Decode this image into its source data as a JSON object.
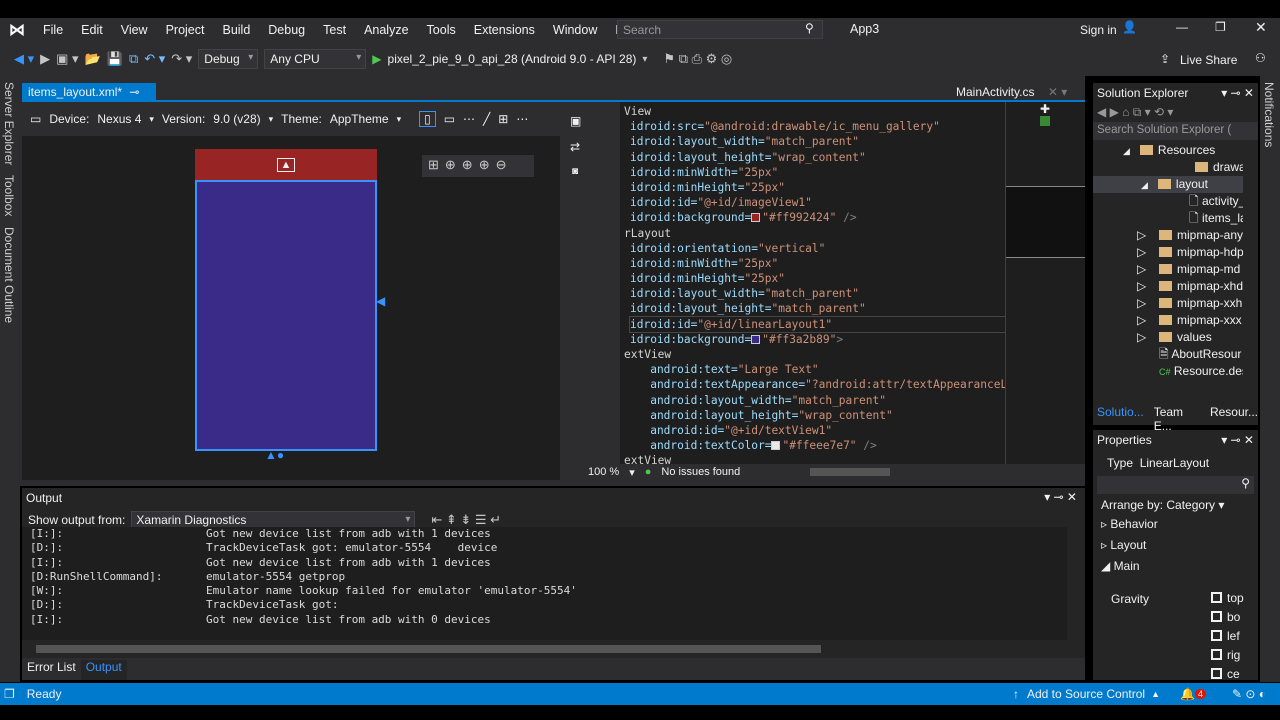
{
  "menu": {
    "items": [
      "File",
      "Edit",
      "View",
      "Project",
      "Build",
      "Debug",
      "Test",
      "Analyze",
      "Tools",
      "Extensions",
      "Window",
      "Help"
    ],
    "search_placeholder": "Search",
    "app_title": "App3",
    "sign_in": "Sign in"
  },
  "toolbar": {
    "config": "Debug",
    "platform": "Any CPU",
    "run_target": "pixel_2_pie_9_0_api_28 (Android 9.0 - API 28)",
    "live_share": "Live Share"
  },
  "left_strip": [
    "Server Explorer",
    "Toolbox",
    "Document Outline"
  ],
  "right_strip": "Notifications",
  "tabs": {
    "active": "items_layout.xml*",
    "other": "MainActivity.cs"
  },
  "designer": {
    "device_label": "Device:",
    "device": "Nexus 4",
    "version_label": "Version:",
    "version": "9.0 (v28)",
    "theme_label": "Theme:",
    "theme": "AppTheme",
    "header_color": "#992424",
    "body_color": "#3a2b89"
  },
  "code": {
    "lines": [
      [
        "View",
        "",
        ""
      ],
      [
        "idroid:src=",
        "\"@android:drawable/ic_menu_gallery\"",
        ""
      ],
      [
        "idroid:layout_width=",
        "\"match_parent\"",
        ""
      ],
      [
        "idroid:layout_height=",
        "\"wrap_content\"",
        ""
      ],
      [
        "idroid:minWidth=",
        "\"25px\"",
        ""
      ],
      [
        "idroid:minHeight=",
        "\"25px\"",
        ""
      ],
      [
        "idroid:id=",
        "\"@+id/imageView1\"",
        ""
      ],
      [
        "idroid:background=",
        "\"#ff992424\"",
        " />"
      ],
      [
        "rLayout",
        "",
        ""
      ],
      [
        "idroid:orientation=",
        "\"vertical\"",
        ""
      ],
      [
        "idroid:minWidth=",
        "\"25px\"",
        ""
      ],
      [
        "idroid:minHeight=",
        "\"25px\"",
        ""
      ],
      [
        "idroid:layout_width=",
        "\"match_parent\"",
        ""
      ],
      [
        "idroid:layout_height=",
        "\"match_parent\"",
        ""
      ],
      [
        "idroid:id=",
        "\"@+id/linearLayout1\"",
        ""
      ],
      [
        "idroid:background=",
        "\"#ff3a2b89\"",
        ">"
      ],
      [
        "extView",
        "",
        ""
      ],
      [
        "   android:text=",
        "\"Large Text\"",
        ""
      ],
      [
        "   android:textAppearance=",
        "\"?android:attr/textAppearanceL",
        ""
      ],
      [
        "   android:layout_width=",
        "\"match_parent\"",
        ""
      ],
      [
        "   android:layout_height=",
        "\"wrap_content\"",
        ""
      ],
      [
        "   android:id=",
        "\"@+id/textView1\"",
        ""
      ],
      [
        "   android:textColor=",
        "\"#ffeee7e7\"",
        " />"
      ],
      [
        "extView",
        "",
        ""
      ]
    ],
    "zoom": "100 %",
    "issues": "No issues found"
  },
  "output": {
    "title": "Output",
    "show_from_label": "Show output from:",
    "source": "Xamarin Diagnostics",
    "lines": [
      [
        "[I:]:",
        "Got new device list from adb with 1 devices"
      ],
      [
        "[D:]:",
        "TrackDeviceTask got: emulator-5554    device"
      ],
      [
        "[I:]:",
        "Got new device list from adb with 1 devices"
      ],
      [
        "[D:RunShellCommand]:",
        "emulator-5554 getprop"
      ],
      [
        "[W:]:",
        "Emulator name lookup failed for emulator 'emulator-5554'"
      ],
      [
        "[D:]:",
        "TrackDeviceTask got:"
      ],
      [
        "[I:]:",
        "Got new device list from adb with 0 devices"
      ]
    ],
    "tabs": [
      "Error List",
      "Output"
    ]
  },
  "solution_explorer": {
    "title": "Solution Explorer",
    "search_placeholder": "Search Solution Explorer (",
    "items": [
      "Resources",
      "drawable",
      "layout",
      "activity_m",
      "items_layo",
      "mipmap-any",
      "mipmap-hdp",
      "mipmap-md",
      "mipmap-xhd",
      "mipmap-xxh",
      "mipmap-xxx",
      "values",
      "AboutResour",
      "Resource.des"
    ],
    "tabs": [
      "Solutio...",
      "Team E...",
      "Resour..."
    ]
  },
  "properties": {
    "title": "Properties",
    "type_label": "Type",
    "type": "LinearLayout",
    "arrange": "Arrange by: Category",
    "categories": [
      "Behavior",
      "Layout",
      "Main"
    ],
    "gravity_label": "Gravity",
    "gravity_options": [
      "top",
      "bo",
      "lef",
      "rig",
      "ce"
    ]
  },
  "status": {
    "ready": "Ready",
    "source_control": "Add to Source Control",
    "notifications": "4",
    "accent": "#007acc"
  }
}
